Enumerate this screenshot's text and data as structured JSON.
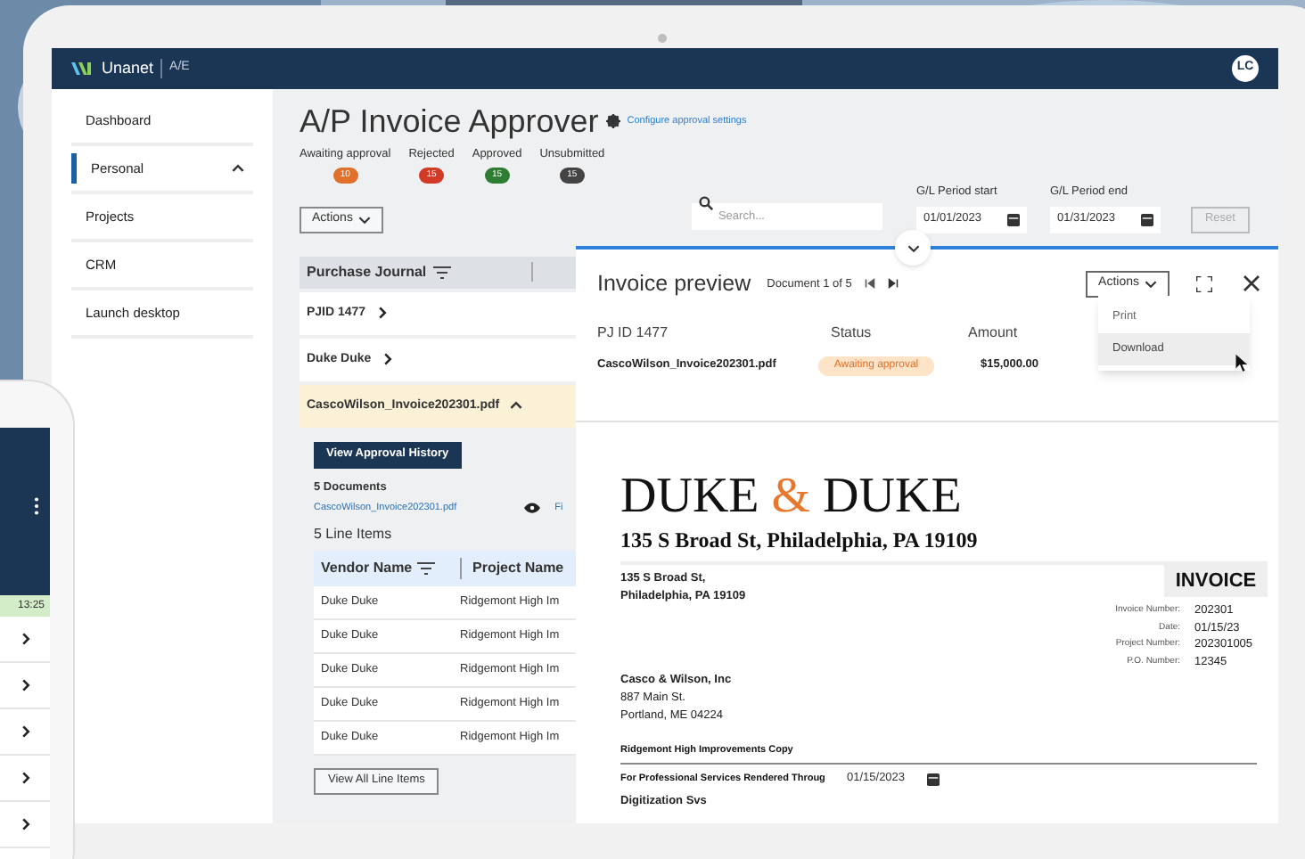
{
  "app": {
    "brand": "Unanet",
    "product": "A/E",
    "user_initials": "LC"
  },
  "sidebar": {
    "items": [
      {
        "label": "Dashboard",
        "kind": "link",
        "selected": false
      },
      {
        "label": "Personal",
        "kind": "group",
        "selected": true
      },
      {
        "label": "Projects",
        "kind": "link",
        "selected": false
      },
      {
        "label": "CRM",
        "kind": "link",
        "selected": false
      },
      {
        "label": "Launch desktop",
        "kind": "link",
        "selected": false
      }
    ]
  },
  "page": {
    "title": "A/P Invoice Approver",
    "settings_link": "Configure approval settings"
  },
  "status_counts": [
    {
      "label": "Awaiting approval",
      "count": "10",
      "color": "#e0702a"
    },
    {
      "label": "Rejected",
      "count": "15",
      "color": "#d23a26"
    },
    {
      "label": "Approved",
      "count": "15",
      "color": "#2e7d32"
    },
    {
      "label": "Unsubmitted",
      "count": "15",
      "color": "#444444"
    }
  ],
  "toolbar": {
    "actions_button": "Actions",
    "search": {
      "placeholder": "Search..."
    },
    "period_start": {
      "label": "G/L Period start",
      "value": "01/01/2023"
    },
    "period_end": {
      "label": "G/L Period end",
      "value": "01/31/2023"
    },
    "reset_button": {
      "label": "Reset",
      "disabled": true
    }
  },
  "journal": {
    "header": "Purchase Journal",
    "rows": [
      {
        "label": "PJID 1477",
        "expanded": false,
        "selected": false
      },
      {
        "label": "Duke Duke",
        "expanded": false,
        "selected": false
      },
      {
        "label": "CascoWilson_Invoice202301.pdf",
        "expanded": true,
        "selected": true
      }
    ]
  },
  "details": {
    "history_button": "View Approval History",
    "documents_count": "5 Documents",
    "document_link": "CascoWilson_Invoice202301.pdf",
    "document_action": "Fi",
    "line_items_title": "5 Line Items",
    "columns": [
      "Vendor Name",
      "Project Name"
    ],
    "rows": [
      [
        "Duke Duke",
        "Ridgemont High Im"
      ],
      [
        "Duke Duke",
        "Ridgemont High Im"
      ],
      [
        "Duke Duke",
        "Ridgemont High Im"
      ],
      [
        "Duke Duke",
        "Ridgemont High Im"
      ],
      [
        "Duke Duke",
        "Ridgemont High Im"
      ]
    ],
    "view_all_button": "View All Line Items"
  },
  "preview": {
    "title": "Invoice preview",
    "document_counter": "Document 1 of 5",
    "actions_button": "Actions",
    "columns": [
      "PJ ID 1477",
      "Status",
      "Amount"
    ],
    "row": {
      "file": "CascoWilson_Invoice202301.pdf",
      "status": "Awaiting approval",
      "amount": "$15,000.00"
    },
    "menu": [
      {
        "label": "Print",
        "selected": false
      },
      {
        "label": "Download",
        "selected": true
      }
    ]
  },
  "invoice": {
    "logo_parts": [
      {
        "text": "DUKE",
        "color": "#111111"
      },
      {
        "text": "&",
        "color": "#e8772e"
      },
      {
        "text": "DUKE",
        "color": "#111111"
      }
    ],
    "address_line": "135 S Broad St, Philadelphia, PA 19109",
    "from_lines": [
      "135 S Broad St,",
      "Philadelphia, PA 19109"
    ],
    "doc_title": "INVOICE",
    "fields": [
      {
        "label": "Invoice Number:",
        "value": "202301"
      },
      {
        "label": "Date:",
        "value": "01/15/23"
      },
      {
        "label": "Project Number:",
        "value": "202301005"
      },
      {
        "label": "P.O. Number:",
        "value": "12345"
      }
    ],
    "bill_to": [
      "Casco & Wilson, Inc",
      "887 Main St.",
      "Portland, ME 04224"
    ],
    "section": "Ridgemont High Improvements Copy",
    "services_label": "For Professional Services Rendered Throug",
    "services_date": "01/15/2023",
    "item": "Digitization Svs"
  },
  "phone": {
    "time": "13:25"
  }
}
